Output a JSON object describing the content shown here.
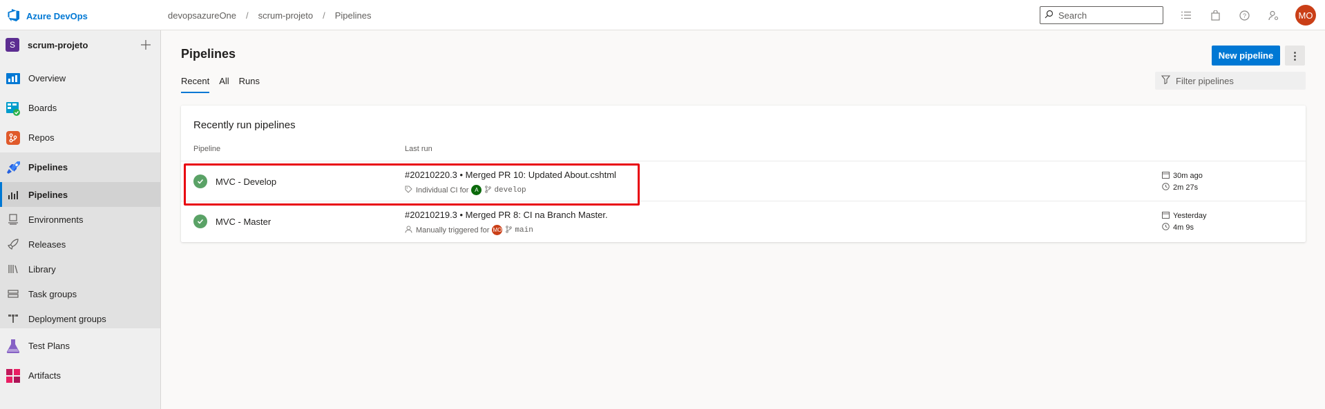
{
  "app": {
    "brand": "Azure DevOps",
    "accent_color": "#0078d4"
  },
  "breadcrumb": [
    "devopsazureOne",
    "scrum-projeto",
    "Pipelines"
  ],
  "search": {
    "placeholder": "Search"
  },
  "header_icons": [
    "list-icon",
    "shopping-bag-icon",
    "help-icon",
    "user-settings-icon"
  ],
  "user": {
    "initials": "MO",
    "avatar_color": "#ca3f17"
  },
  "sidebar": {
    "project": {
      "badge": "S",
      "name": "scrum-projeto",
      "badge_color": "#5c2d91"
    },
    "items": [
      {
        "label": "Overview",
        "icon": "overview-icon"
      },
      {
        "label": "Boards",
        "icon": "boards-icon"
      },
      {
        "label": "Repos",
        "icon": "repos-icon"
      },
      {
        "label": "Pipelines",
        "icon": "pipelines-icon"
      },
      {
        "label": "Pipelines",
        "icon": "pipelines-sub-icon",
        "selected": true
      },
      {
        "label": "Environments",
        "icon": "environments-icon"
      },
      {
        "label": "Releases",
        "icon": "rocket-icon"
      },
      {
        "label": "Library",
        "icon": "library-icon"
      },
      {
        "label": "Task groups",
        "icon": "task-groups-icon"
      },
      {
        "label": "Deployment groups",
        "icon": "deployment-groups-icon"
      },
      {
        "label": "Test Plans",
        "icon": "flask-icon"
      },
      {
        "label": "Artifacts",
        "icon": "artifacts-icon"
      }
    ]
  },
  "main": {
    "title": "Pipelines",
    "tabs": [
      {
        "label": "Recent",
        "active": true
      },
      {
        "label": "All"
      },
      {
        "label": "Runs"
      }
    ],
    "new_pipeline_label": "New pipeline",
    "more_label": "⋮",
    "filter_placeholder": "Filter pipelines",
    "card": {
      "title": "Recently run pipelines",
      "columns": {
        "pipeline": "Pipeline",
        "last_run": "Last run"
      },
      "rows": [
        {
          "name": "MVC - Develop",
          "status": "succeeded",
          "run_title": "#20210220.3 • Merged PR 10: Updated About.cshtml",
          "trigger_text": "Individual CI for",
          "trigger_avatar": "A",
          "trigger_avatar_color": "#0b6a0b",
          "branch": "develop",
          "when": "30m ago",
          "duration": "2m 27s",
          "highlighted": true
        },
        {
          "name": "MVC - Master",
          "status": "succeeded",
          "run_title": "#20210219.3 • Merged PR 8: CI na Branch Master.",
          "trigger_text": "Manually triggered for",
          "trigger_avatar": "MO",
          "trigger_avatar_color": "#ca3f17",
          "branch": "main",
          "when": "Yesterday",
          "duration": "4m 9s"
        }
      ]
    }
  }
}
